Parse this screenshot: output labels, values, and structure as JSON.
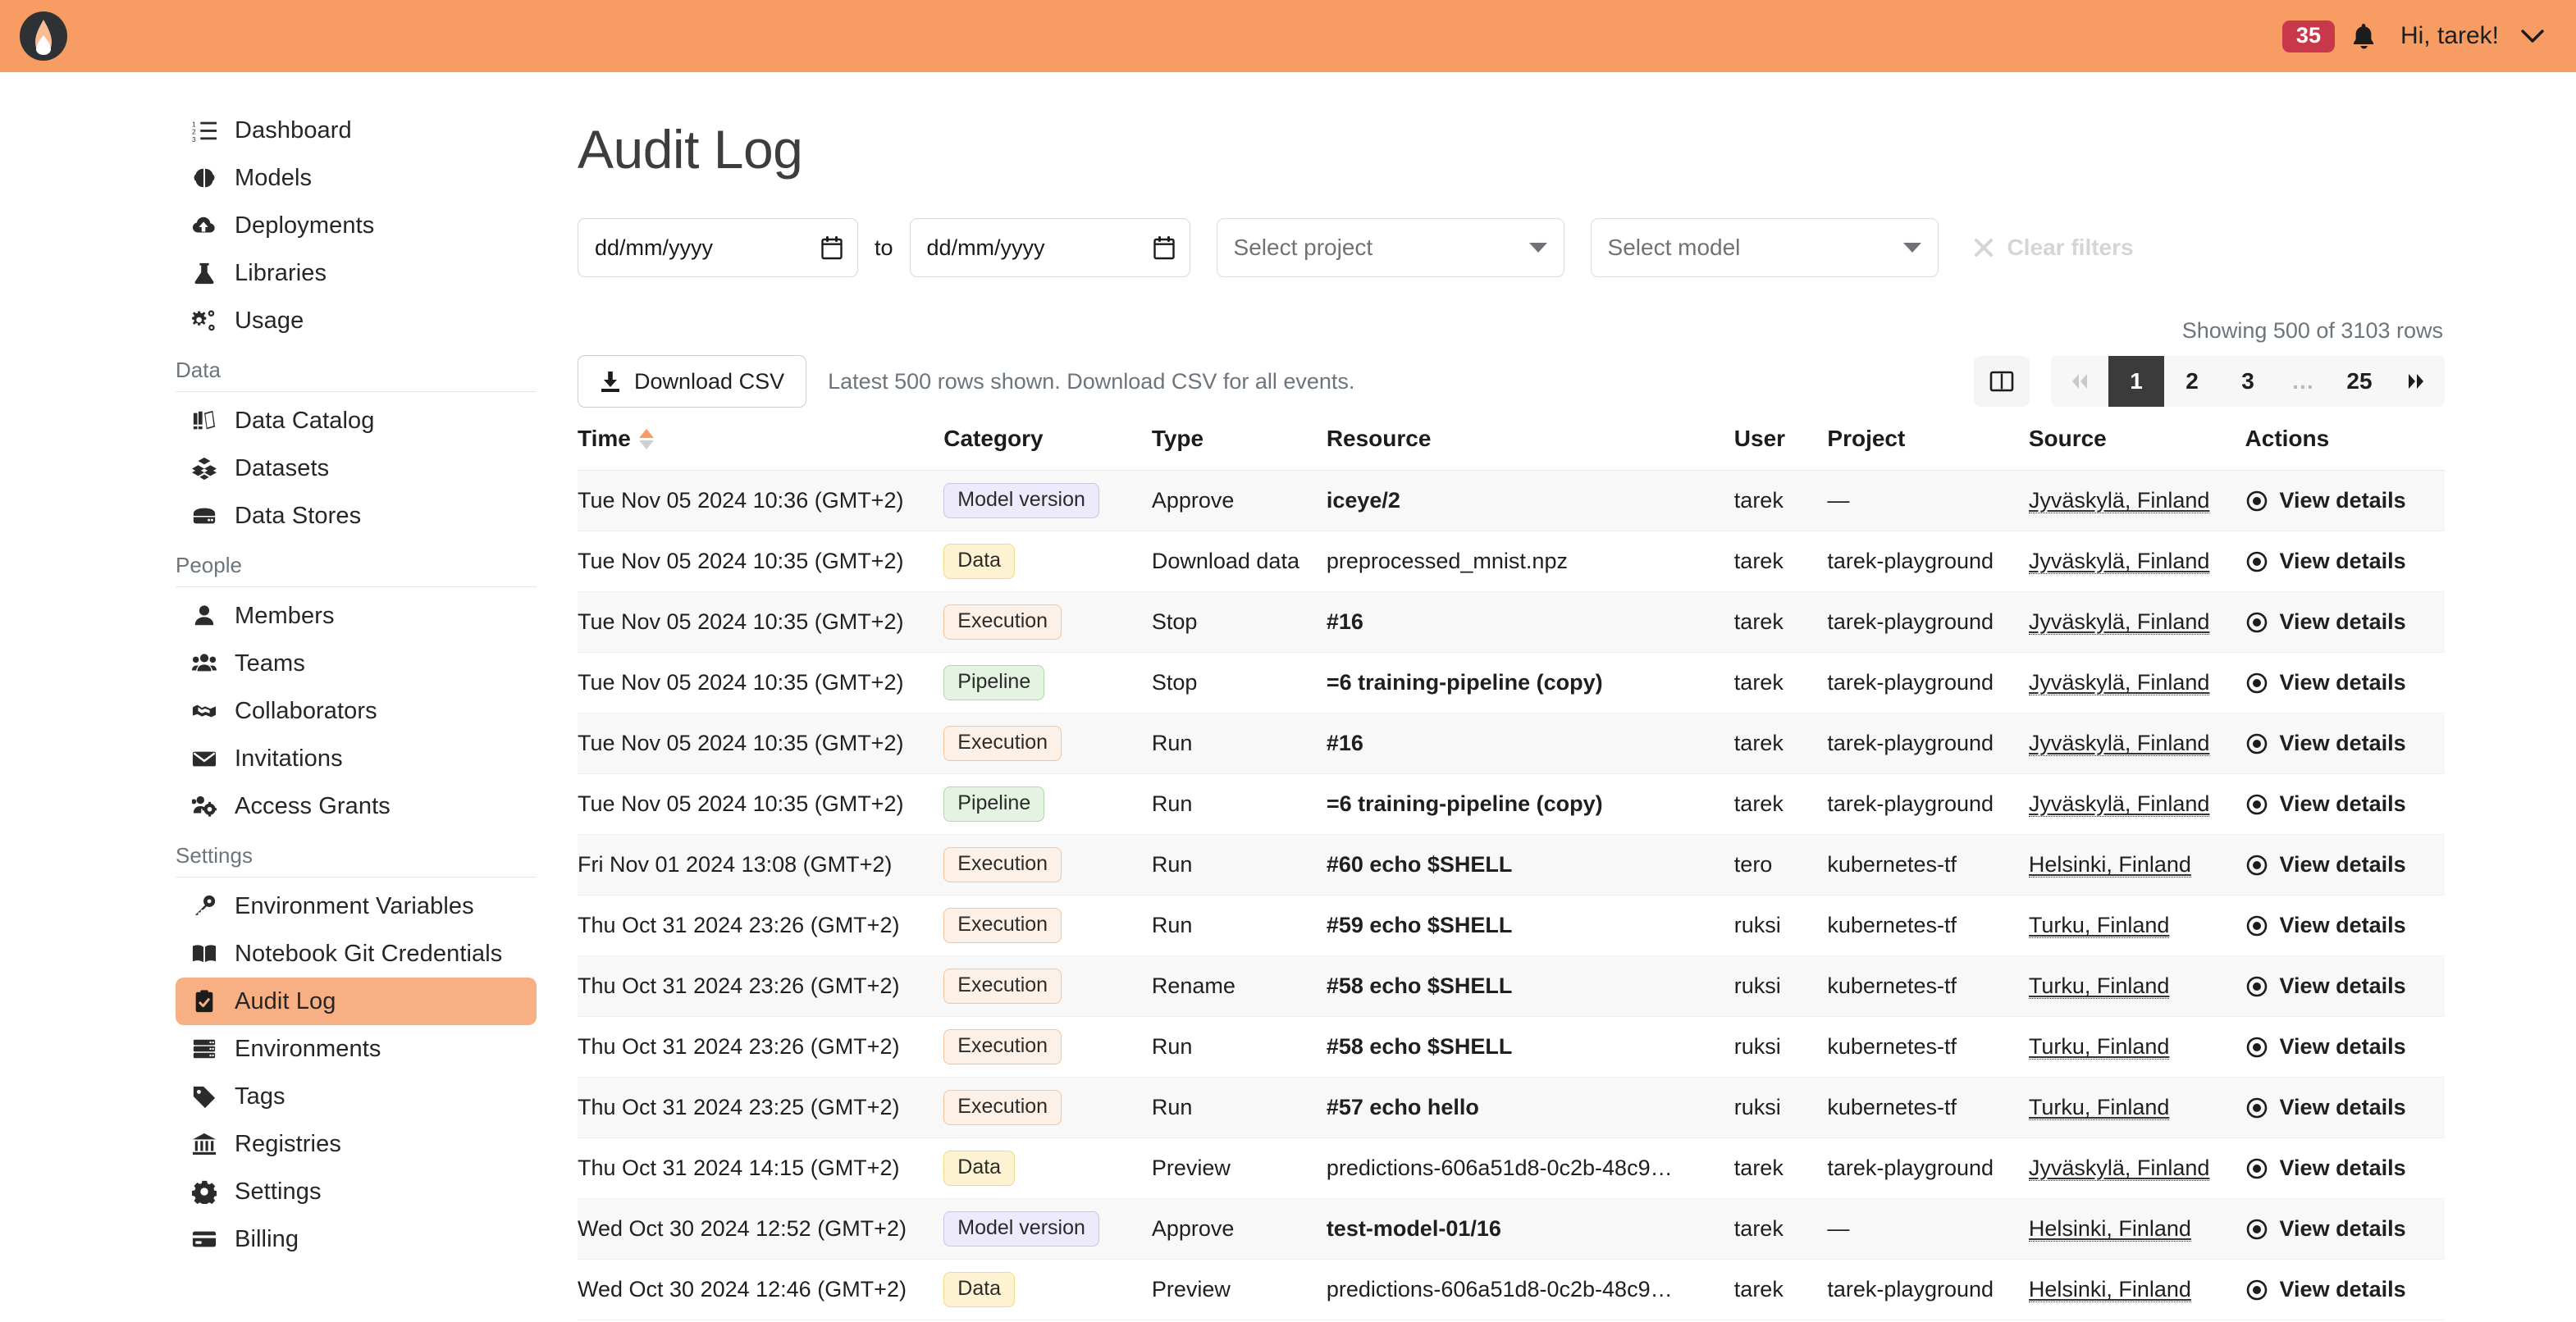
{
  "topbar": {
    "logo_icon": "flame-logo-icon",
    "notification_count": "35",
    "bell_icon": "bell-icon",
    "greeting": "Hi, tarek!",
    "chevron_icon": "chevron-down-icon"
  },
  "sidebar": {
    "groups": [
      {
        "label": null,
        "items": [
          {
            "label": "Dashboard",
            "icon": "list-ordered-icon",
            "active": false
          },
          {
            "label": "Models",
            "icon": "brain-icon",
            "active": false
          },
          {
            "label": "Deployments",
            "icon": "cloud-upload-icon",
            "active": false
          },
          {
            "label": "Libraries",
            "icon": "flask-icon",
            "active": false
          },
          {
            "label": "Usage",
            "icon": "gears-icon",
            "active": false
          }
        ]
      },
      {
        "label": "Data",
        "items": [
          {
            "label": "Data Catalog",
            "icon": "books-icon",
            "active": false
          },
          {
            "label": "Datasets",
            "icon": "boxes-icon",
            "active": false
          },
          {
            "label": "Data Stores",
            "icon": "server-icon",
            "active": false
          }
        ]
      },
      {
        "label": "People",
        "items": [
          {
            "label": "Members",
            "icon": "user-icon",
            "active": false
          },
          {
            "label": "Teams",
            "icon": "users-icon",
            "active": false
          },
          {
            "label": "Collaborators",
            "icon": "handshake-icon",
            "active": false
          },
          {
            "label": "Invitations",
            "icon": "envelope-icon",
            "active": false
          },
          {
            "label": "Access Grants",
            "icon": "users-gear-icon",
            "active": false
          }
        ]
      },
      {
        "label": "Settings",
        "items": [
          {
            "label": "Environment Variables",
            "icon": "key-icon",
            "active": false
          },
          {
            "label": "Notebook Git Credentials",
            "icon": "book-open-icon",
            "active": false
          },
          {
            "label": "Audit Log",
            "icon": "clipboard-check-icon",
            "active": true
          },
          {
            "label": "Environments",
            "icon": "servers-icon",
            "active": false
          },
          {
            "label": "Tags",
            "icon": "tag-icon",
            "active": false
          },
          {
            "label": "Registries",
            "icon": "bank-icon",
            "active": false
          },
          {
            "label": "Settings",
            "icon": "gear-icon",
            "active": false
          },
          {
            "label": "Billing",
            "icon": "credit-card-icon",
            "active": false
          }
        ]
      }
    ]
  },
  "page": {
    "title": "Audit Log"
  },
  "filters": {
    "date_from_placeholder": "dd/mm/yyyy",
    "date_from_value": "",
    "to_label": "to",
    "date_to_placeholder": "dd/mm/yyyy",
    "date_to_value": "",
    "project_select_value": "Select project",
    "model_select_value": "Select model",
    "clear_filters_label": "Clear filters",
    "clear_filters_enabled": false,
    "calendar_icon": "calendar-icon",
    "close_icon": "close-icon"
  },
  "toolbar": {
    "download_csv_label": "Download CSV",
    "download_icon": "download-icon",
    "note": "Latest 500 rows shown. Download CSV for all events.",
    "rows_info": "Showing 500 of 3103 rows",
    "columns_icon": "columns-icon",
    "prev_icon": "double-chevron-left-icon",
    "next_icon": "double-chevron-right-icon",
    "pages": [
      "1",
      "2",
      "3",
      "…",
      "25"
    ],
    "active_page": "1"
  },
  "table": {
    "columns": [
      "Time",
      "Category",
      "Type",
      "Resource",
      "User",
      "Project",
      "Source",
      "Actions"
    ],
    "sorted_column": "Time",
    "sort_direction": "asc",
    "view_details_label": "View details",
    "view_details_icon": "eye-icon",
    "rows": [
      {
        "time": "Tue Nov 05 2024 10:36 (GMT+2)",
        "category": "Model version",
        "cat_class": "modelversion",
        "type": "Approve",
        "resource": "iceye/2",
        "res_bold": true,
        "user": "tarek",
        "project": "—",
        "source": "Jyväskylä, Finland"
      },
      {
        "time": "Tue Nov 05 2024 10:35 (GMT+2)",
        "category": "Data",
        "cat_class": "data",
        "type": "Download data",
        "resource": "preprocessed_mnist.npz",
        "res_bold": false,
        "user": "tarek",
        "project": "tarek-playground",
        "source": "Jyväskylä, Finland"
      },
      {
        "time": "Tue Nov 05 2024 10:35 (GMT+2)",
        "category": "Execution",
        "cat_class": "execution",
        "type": "Stop",
        "resource": "#16",
        "res_bold": true,
        "user": "tarek",
        "project": "tarek-playground",
        "source": "Jyväskylä, Finland"
      },
      {
        "time": "Tue Nov 05 2024 10:35 (GMT+2)",
        "category": "Pipeline",
        "cat_class": "pipeline",
        "type": "Stop",
        "resource": "=6 training-pipeline (copy)",
        "res_bold": true,
        "user": "tarek",
        "project": "tarek-playground",
        "source": "Jyväskylä, Finland"
      },
      {
        "time": "Tue Nov 05 2024 10:35 (GMT+2)",
        "category": "Execution",
        "cat_class": "execution",
        "type": "Run",
        "resource": "#16",
        "res_bold": true,
        "user": "tarek",
        "project": "tarek-playground",
        "source": "Jyväskylä, Finland"
      },
      {
        "time": "Tue Nov 05 2024 10:35 (GMT+2)",
        "category": "Pipeline",
        "cat_class": "pipeline",
        "type": "Run",
        "resource": "=6 training-pipeline (copy)",
        "res_bold": true,
        "user": "tarek",
        "project": "tarek-playground",
        "source": "Jyväskylä, Finland"
      },
      {
        "time": "Fri Nov 01 2024 13:08 (GMT+2)",
        "category": "Execution",
        "cat_class": "execution",
        "type": "Run",
        "resource": "#60 echo $SHELL",
        "res_bold": true,
        "user": "tero",
        "project": "kubernetes-tf",
        "source": "Helsinki, Finland"
      },
      {
        "time": "Thu Oct 31 2024 23:26 (GMT+2)",
        "category": "Execution",
        "cat_class": "execution",
        "type": "Run",
        "resource": "#59 echo $SHELL",
        "res_bold": true,
        "user": "ruksi",
        "project": "kubernetes-tf",
        "source": "Turku, Finland"
      },
      {
        "time": "Thu Oct 31 2024 23:26 (GMT+2)",
        "category": "Execution",
        "cat_class": "execution",
        "type": "Rename",
        "resource": "#58 echo $SHELL",
        "res_bold": true,
        "user": "ruksi",
        "project": "kubernetes-tf",
        "source": "Turku, Finland"
      },
      {
        "time": "Thu Oct 31 2024 23:26 (GMT+2)",
        "category": "Execution",
        "cat_class": "execution",
        "type": "Run",
        "resource": "#58 echo $SHELL",
        "res_bold": true,
        "user": "ruksi",
        "project": "kubernetes-tf",
        "source": "Turku, Finland"
      },
      {
        "time": "Thu Oct 31 2024 23:25 (GMT+2)",
        "category": "Execution",
        "cat_class": "execution",
        "type": "Run",
        "resource": "#57 echo hello",
        "res_bold": true,
        "user": "ruksi",
        "project": "kubernetes-tf",
        "source": "Turku, Finland"
      },
      {
        "time": "Thu Oct 31 2024 14:15 (GMT+2)",
        "category": "Data",
        "cat_class": "data",
        "type": "Preview",
        "resource": "predictions-606a51d8-0c2b-48c9…",
        "res_bold": false,
        "user": "tarek",
        "project": "tarek-playground",
        "source": "Jyväskylä, Finland"
      },
      {
        "time": "Wed Oct 30 2024 12:52 (GMT+2)",
        "category": "Model version",
        "cat_class": "modelversion",
        "type": "Approve",
        "resource": "test-model-01/16",
        "res_bold": true,
        "user": "tarek",
        "project": "—",
        "source": "Helsinki, Finland"
      },
      {
        "time": "Wed Oct 30 2024 12:46 (GMT+2)",
        "category": "Data",
        "cat_class": "data",
        "type": "Preview",
        "resource": "predictions-606a51d8-0c2b-48c9…",
        "res_bold": false,
        "user": "tarek",
        "project": "tarek-playground",
        "source": "Helsinki, Finland"
      }
    ]
  }
}
